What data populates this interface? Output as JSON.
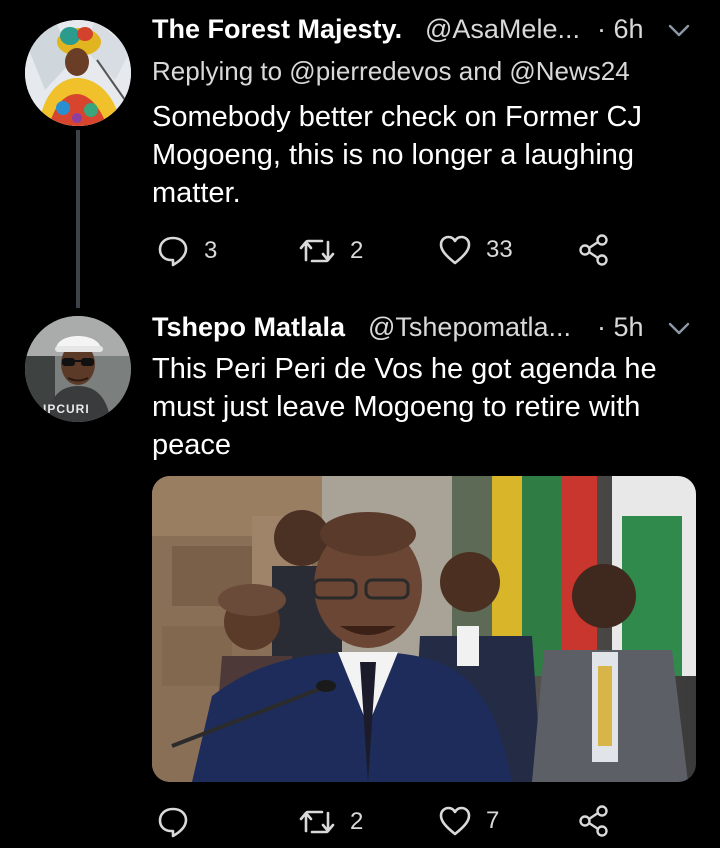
{
  "tweets": [
    {
      "display_name": "The Forest Majesty.",
      "handle": "@AsaMele...",
      "time": "· 6h",
      "replying_to": "Replying to @pierredevos and @News24",
      "text": "Somebody better check on Former CJ Mogoeng, this is no longer a laughing matter.",
      "actions": {
        "replies": "3",
        "retweets": "2",
        "likes": "33"
      }
    },
    {
      "display_name": "Tshepo Matlala",
      "handle": "@Tshepomatla...",
      "time": "· 5h",
      "text": "This Peri Peri de Vos he got agenda he must just leave Mogoeng to retire with peace",
      "actions": {
        "replies": "",
        "retweets": "2",
        "likes": "7"
      },
      "avatar_shirt_text": "IPCURI"
    }
  ],
  "icons": {
    "reply": "speech-bubble-icon",
    "retweet": "retweet-arrows-icon",
    "like": "heart-icon",
    "share": "share-icon",
    "menu": "chevron-down-icon"
  },
  "colors": {
    "background": "#000000",
    "text": "#ffffff",
    "secondary": "#d9d9d9",
    "thread_line": "#3d4248"
  }
}
